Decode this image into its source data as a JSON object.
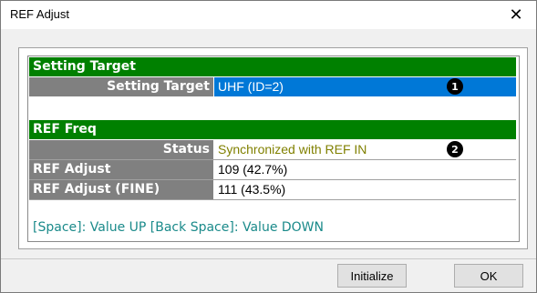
{
  "window": {
    "title": "REF Adjust",
    "close_glyph": "✕",
    "close_icon": "close-icon"
  },
  "setting_target": {
    "header": "Setting Target",
    "label": "Setting Target",
    "value": "UHF (ID=2)",
    "marker": "1",
    "value_bg": "#0078d7"
  },
  "ref_freq": {
    "header": "REF Freq",
    "status_label": "Status",
    "status_value": "Synchronized with REF IN",
    "status_color": "#808000",
    "marker": "2",
    "adjust_label": "REF Adjust",
    "adjust_value": "109 (42.7%)",
    "fine_label": "REF Adjust (FINE)",
    "fine_value": "111 (43.5%)"
  },
  "hint": "[Space]: Value UP  [Back Space]: Value DOWN",
  "buttons": {
    "initialize": "Initialize",
    "ok": "OK"
  },
  "colors": {
    "header_green": "#008000",
    "label_gray": "#808080",
    "hint_teal": "#1a8a8a"
  }
}
